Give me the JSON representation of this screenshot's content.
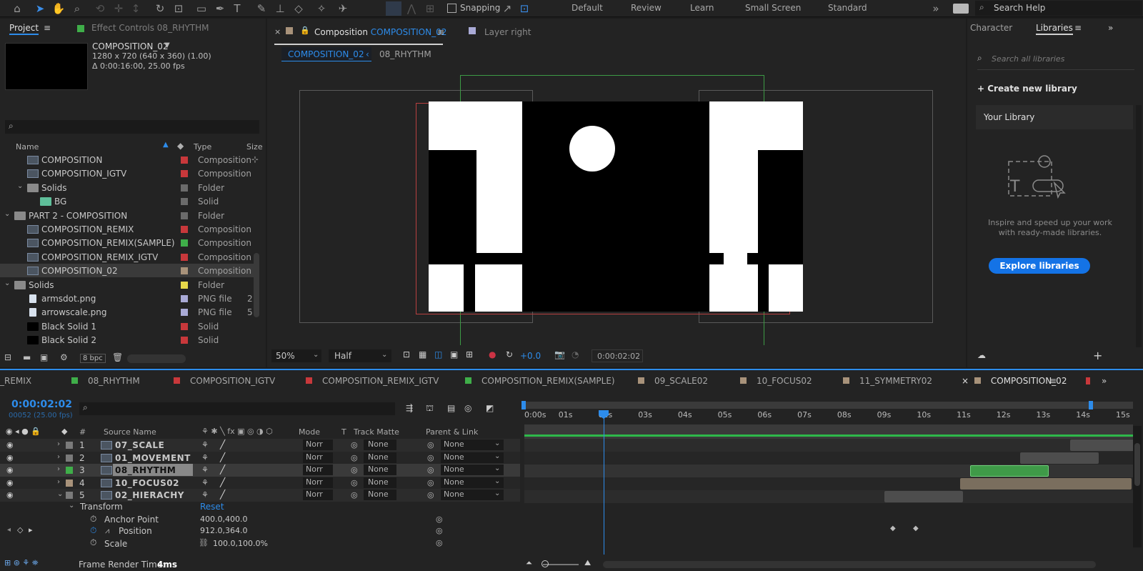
{
  "toolbar": {
    "snapping": "Snapping",
    "workspaces": [
      "Default",
      "Review",
      "Learn",
      "Small Screen",
      "Standard"
    ],
    "search_help": "Search Help"
  },
  "project_panel": {
    "tab_project": "Project",
    "tab_effect_controls": "Effect Controls 08_RHYTHM",
    "comp_name": "COMPOSITION_02",
    "comp_size": "1280 x 720  (640 x 360) (1.00)",
    "comp_duration": "Δ 0:00:16:00, 25.00 fps",
    "col_name": "Name",
    "col_type": "Type",
    "col_size": "Size",
    "bpc": "8 bpc",
    "items": [
      {
        "name": "COMPOSITION",
        "type": "Composition",
        "color": "#c8383b",
        "indent": 1,
        "kind": "comp"
      },
      {
        "name": "COMPOSITION_IGTV",
        "type": "Composition",
        "color": "#c8383b",
        "indent": 1,
        "kind": "comp"
      },
      {
        "name": "Solids",
        "type": "Folder",
        "color": "#6b6b6b",
        "indent": 1,
        "kind": "folder"
      },
      {
        "name": "BG",
        "type": "Solid",
        "color": "#6b6b6b",
        "indent": 2,
        "kind": "solid"
      },
      {
        "name": "PART 2 - COMPOSITION",
        "type": "Folder",
        "color": "#6b6b6b",
        "indent": 0,
        "kind": "folder"
      },
      {
        "name": "COMPOSITION_REMIX",
        "type": "Composition",
        "color": "#c8383b",
        "indent": 1,
        "kind": "comp"
      },
      {
        "name": "COMPOSITION_REMIX(SAMPLE)",
        "type": "Composition",
        "color": "#3fae49",
        "indent": 1,
        "kind": "comp"
      },
      {
        "name": "COMPOSITION_REMIX_IGTV",
        "type": "Composition",
        "color": "#c8383b",
        "indent": 1,
        "kind": "comp"
      },
      {
        "name": "COMPOSITION_02",
        "type": "Composition",
        "color": "#a8927a",
        "indent": 1,
        "kind": "comp",
        "selected": true
      },
      {
        "name": "Solids",
        "type": "Folder",
        "color": "#e6d84a",
        "indent": 0,
        "kind": "folder"
      },
      {
        "name": "armsdot.png",
        "type": "PNG file",
        "color": "#a9aad6",
        "indent": 1,
        "kind": "png",
        "size": "2"
      },
      {
        "name": "arrowscale.png",
        "type": "PNG file",
        "color": "#a9aad6",
        "indent": 1,
        "kind": "png",
        "size": "5"
      },
      {
        "name": "Black Solid 1",
        "type": "Solid",
        "color": "#c8383b",
        "indent": 1,
        "kind": "black"
      },
      {
        "name": "Black Solid 2",
        "type": "Solid",
        "color": "#c8383b",
        "indent": 1,
        "kind": "black"
      }
    ]
  },
  "viewer": {
    "tab_composition": "Composition",
    "tab_comp_name": "COMPOSITION_02",
    "tab_layer": "Layer  right",
    "crumb_active": "COMPOSITION_02",
    "crumb_next": "08_RHYTHM",
    "zoom": "50%",
    "resolution": "Half",
    "exposure": "+0.0",
    "timecode": "0:00:02:02"
  },
  "libraries": {
    "tab_character": "Character",
    "tab_libraries": "Libraries",
    "search_placeholder": "Search all libraries",
    "create": "Create new library",
    "your_library": "Your Library",
    "inspire": "Inspire and speed up your work with ready-made libraries.",
    "explore": "Explore libraries"
  },
  "timeline": {
    "tabs": [
      {
        "label": "_REMIX",
        "color": ""
      },
      {
        "label": "08_RHYTHM",
        "color": "#3fae49"
      },
      {
        "label": "COMPOSITION_IGTV",
        "color": "#c8383b"
      },
      {
        "label": "COMPOSITION_REMIX_IGTV",
        "color": "#c8383b"
      },
      {
        "label": "COMPOSITION_REMIX(SAMPLE)",
        "color": "#3fae49"
      },
      {
        "label": "09_SCALE02",
        "color": "#a8927a"
      },
      {
        "label": "10_FOCUS02",
        "color": "#a8927a"
      },
      {
        "label": "11_SYMMETRY02",
        "color": "#a8927a"
      },
      {
        "label": "COMPOSITION_02",
        "color": "#a8927a"
      }
    ],
    "current_time": "0:00:02:02",
    "frame_info": "00052 (25.00 fps)",
    "col_source": "Source Name",
    "col_mode": "Mode",
    "col_t": "T",
    "col_track": "Track Matte",
    "col_parent": "Parent & Link",
    "ruler": [
      "0:00s",
      "01s",
      "02s",
      "03s",
      "04s",
      "05s",
      "06s",
      "07s",
      "08s",
      "09s",
      "10s",
      "11s",
      "12s",
      "13s",
      "14s",
      "15s"
    ],
    "layers": [
      {
        "num": "1",
        "name": "07_SCALE",
        "color": "#7a7a7a",
        "mode": "Norr",
        "matte": "None",
        "parent": "None"
      },
      {
        "num": "2",
        "name": "01_MOVEMENT",
        "color": "#7a7a7a",
        "mode": "Norr",
        "matte": "None",
        "parent": "None"
      },
      {
        "num": "3",
        "name": "08_RHYTHM",
        "color": "#3fae49",
        "mode": "Norr",
        "matte": "None",
        "parent": "None"
      },
      {
        "num": "4",
        "name": "10_FOCUS02",
        "color": "#a8927a",
        "mode": "Norr",
        "matte": "None",
        "parent": "None"
      },
      {
        "num": "5",
        "name": "02_HIERACHY",
        "color": "#7a7a7a",
        "mode": "Norr",
        "matte": "None",
        "parent": "None"
      }
    ],
    "transform": "Transform",
    "reset": "Reset",
    "props": [
      {
        "name": "Anchor Point",
        "value": "400.0,400.0"
      },
      {
        "name": "Position",
        "value": "912.0,364.0"
      },
      {
        "name": "Scale",
        "value": "100.0,100.0%"
      }
    ],
    "render_label": "Frame Render Time:",
    "render_value": "4ms"
  }
}
